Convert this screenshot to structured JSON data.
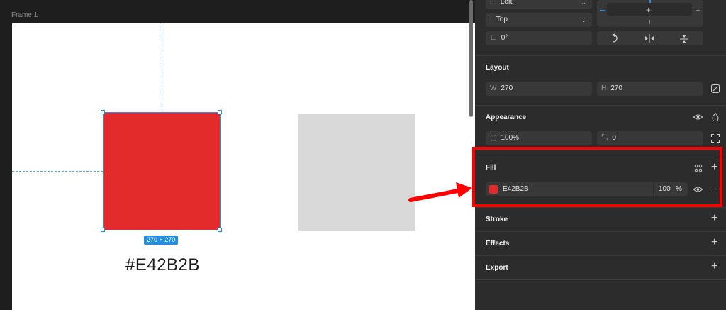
{
  "canvas": {
    "frame_label": "Frame 1",
    "size_badge": "270 × 270",
    "hex_caption": "#E42B2B"
  },
  "panel": {
    "align_h": "Left",
    "align_v": "Top",
    "rotation": "0°",
    "layout": {
      "title": "Layout",
      "w_label": "W",
      "w_value": "270",
      "h_label": "H",
      "h_value": "270"
    },
    "appearance": {
      "title": "Appearance",
      "opacity": "100%",
      "radius": "0"
    },
    "fill": {
      "title": "Fill",
      "color_hex": "E42B2B",
      "opacity_value": "100",
      "opacity_unit": "%"
    },
    "stroke_title": "Stroke",
    "effects_title": "Effects",
    "export_title": "Export"
  },
  "colors": {
    "swatch": "#e42b2b",
    "highlight": "#ff0000",
    "selection": "#1f8fe8"
  }
}
